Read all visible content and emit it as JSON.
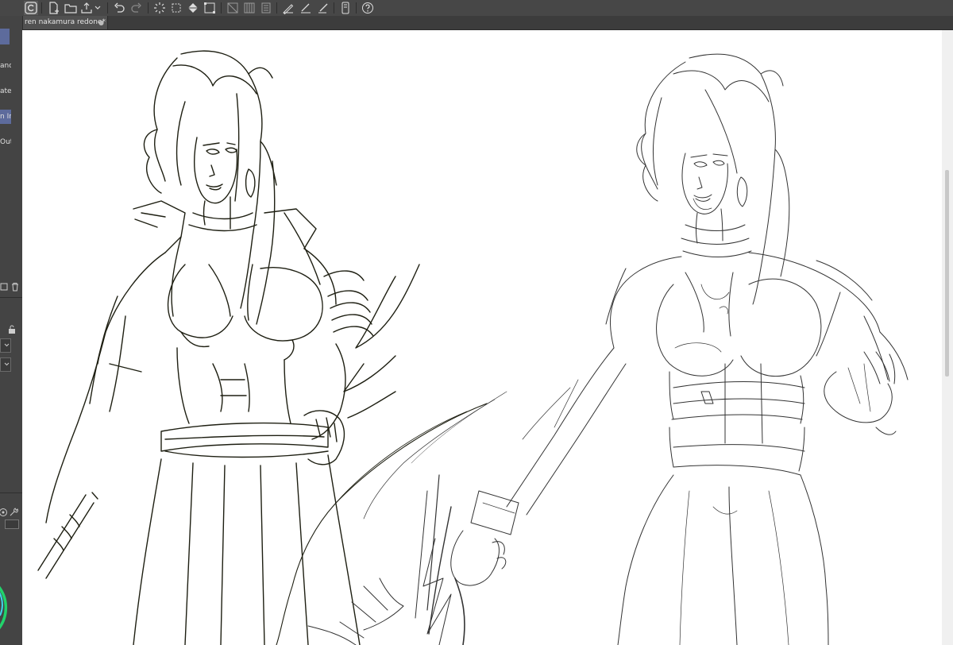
{
  "toolbar": {
    "icons": [
      "clip-studio-icon",
      "new-canvas-icon",
      "open-file-icon",
      "export-icon",
      "undo-icon",
      "redo-icon",
      "loading-icon",
      "transform-icon",
      "fill-icon",
      "select-icon",
      "grid-icon",
      "ruler-icon",
      "layer-icon",
      "pen-correction-icon",
      "stabilizer-icon",
      "smartphone-icon",
      "help-icon"
    ]
  },
  "document_tab": {
    "title": "ren nakamura redone*",
    "close_symbol": "●"
  },
  "left_panel": {
    "items": [
      {
        "label": "and",
        "selected": false
      },
      {
        "label": "ate",
        "selected": false
      },
      {
        "label": "n In",
        "selected": true
      },
      {
        "label": "Out",
        "selected": false
      }
    ],
    "color_accent": "#1fd46a"
  },
  "canvas": {
    "background": "#ffffff",
    "ink_left": "#1e1f12",
    "ink_right": "#333333"
  }
}
